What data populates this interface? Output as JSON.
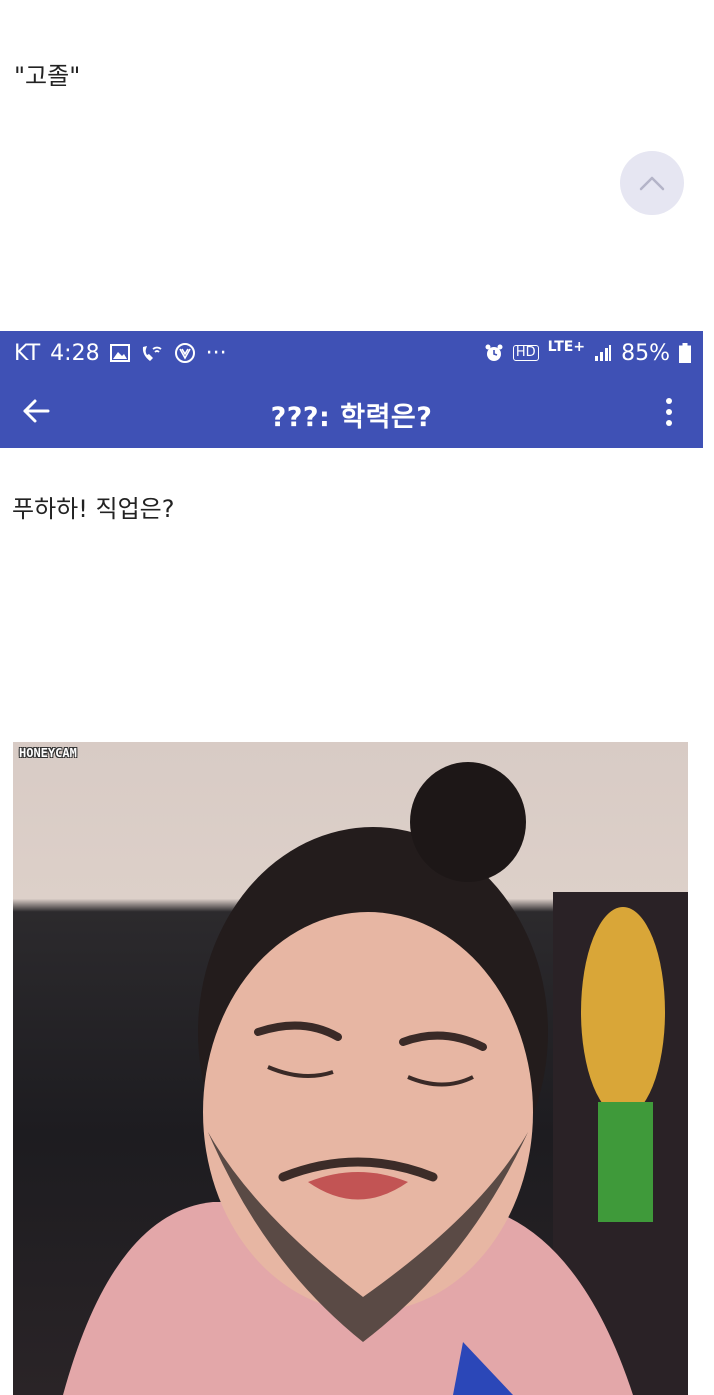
{
  "top_quote": "\"고졸\"",
  "status_bar": {
    "carrier": "KT",
    "time": "4:28",
    "more": "···",
    "hd_tag": "HD",
    "lte": "LTE+",
    "battery": "85%"
  },
  "app_bar": {
    "title": "???: 학력은?"
  },
  "post": {
    "text": "푸하하! 직업은?",
    "image_watermark": "HONEYCAM"
  },
  "icons": {
    "scroll_top": "chevron-up-icon",
    "back": "arrow-left-icon",
    "menu": "more-vert-icon"
  },
  "colors": {
    "app_bar": "#3f51b5",
    "scroll_btn": "#e6e6f2"
  }
}
